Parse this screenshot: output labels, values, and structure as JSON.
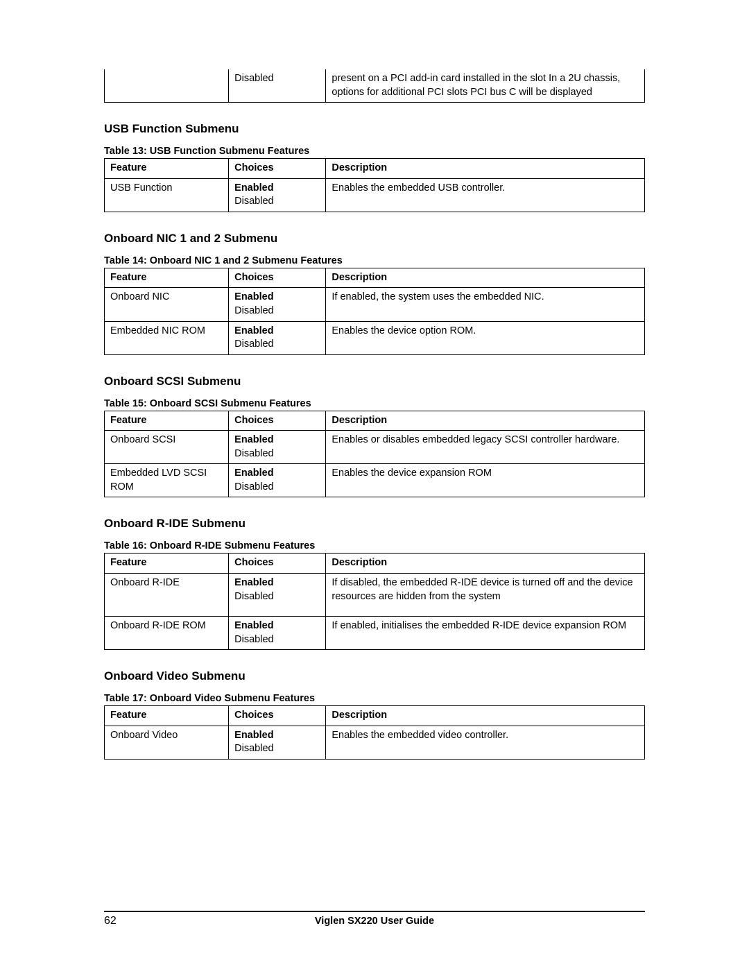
{
  "fragment_table": {
    "col2": "Disabled",
    "col3": "present on a PCI add-in card installed in the slot In a 2U chassis, options for additional PCI slots PCI bus C will be displayed"
  },
  "common_headers": {
    "feature": "Feature",
    "choices": "Choices",
    "description": "Description"
  },
  "sections": {
    "usb": {
      "heading": "USB Function Submenu",
      "caption": "Table 13: USB Function Submenu Features",
      "rows": [
        {
          "feature": "USB Function",
          "choice_bold": "Enabled",
          "choice_plain": "Disabled",
          "description": "Enables the embedded USB controller."
        }
      ]
    },
    "nic": {
      "heading": "Onboard NIC 1 and 2 Submenu",
      "caption": "Table 14: Onboard NIC 1 and 2 Submenu Features",
      "rows": [
        {
          "feature": "Onboard NIC",
          "choice_bold": "Enabled",
          "choice_plain": "Disabled",
          "description": "If enabled, the system uses the embedded NIC."
        },
        {
          "feature": "Embedded NIC ROM",
          "choice_bold": "Enabled",
          "choice_plain": "Disabled",
          "description": "Enables the device option ROM."
        }
      ]
    },
    "scsi": {
      "heading": "Onboard SCSI Submenu",
      "caption": "Table 15: Onboard SCSI Submenu Features",
      "rows": [
        {
          "feature": "Onboard SCSI",
          "choice_bold": "Enabled",
          "choice_plain": "Disabled",
          "description": "Enables or disables embedded legacy SCSI controller hardware."
        },
        {
          "feature": "Embedded LVD SCSI ROM",
          "choice_bold": "Enabled",
          "choice_plain": "Disabled",
          "description": "Enables the device expansion ROM"
        }
      ]
    },
    "ride": {
      "heading": "Onboard R-IDE Submenu",
      "caption": "Table 16: Onboard R-IDE Submenu Features",
      "rows": [
        {
          "feature": "Onboard R-IDE",
          "choice_bold": "Enabled",
          "choice_plain": "Disabled",
          "description": "If disabled, the embedded R-IDE device is turned off and the device resources are hidden from the system"
        },
        {
          "feature": "Onboard R-IDE ROM",
          "choice_bold": "Enabled",
          "choice_plain": "Disabled",
          "description": "If enabled, initialises the embedded R-IDE device expansion ROM"
        }
      ]
    },
    "video": {
      "heading": "Onboard Video Submenu",
      "caption": "Table 17: Onboard Video Submenu Features",
      "rows": [
        {
          "feature": "Onboard Video",
          "choice_bold": "Enabled",
          "choice_plain": "Disabled",
          "description": "Enables the embedded video controller."
        }
      ]
    }
  },
  "footer": {
    "page_number": "62",
    "title": "Viglen SX220 User Guide"
  }
}
